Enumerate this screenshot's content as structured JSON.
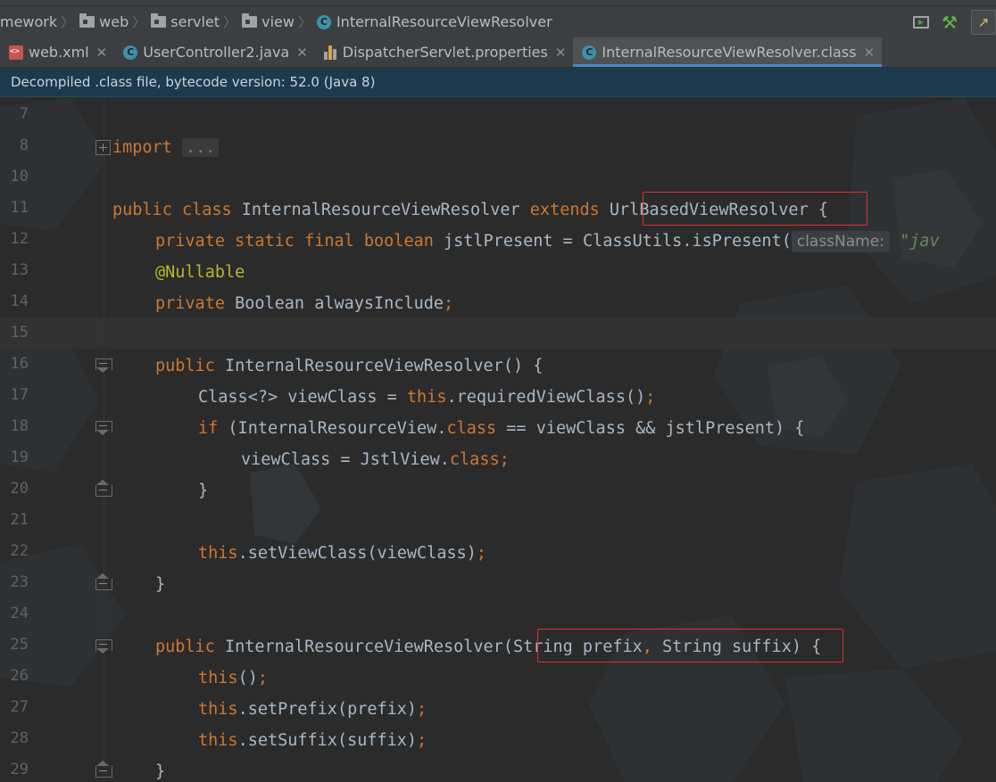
{
  "breadcrumb": {
    "items": [
      {
        "label": "mework",
        "icon": "none"
      },
      {
        "label": "web",
        "icon": "folder-icon"
      },
      {
        "label": "servlet",
        "icon": "folder-icon"
      },
      {
        "label": "view",
        "icon": "folder-icon"
      },
      {
        "label": "InternalResourceViewResolver",
        "icon": "class-icon"
      }
    ]
  },
  "toolbar": {
    "icons": [
      "run-configuration-icon",
      "build-hammer-icon",
      "run-icon"
    ]
  },
  "tabs": [
    {
      "label": "web.xml",
      "icon": "xml-file-icon",
      "active": false
    },
    {
      "label": "UserController2.java",
      "icon": "java-class-icon",
      "active": false
    },
    {
      "label": "DispatcherServlet.properties",
      "icon": "properties-file-icon",
      "active": false
    },
    {
      "label": "InternalResourceViewResolver.class",
      "icon": "java-class-icon",
      "active": true
    }
  ],
  "banner": {
    "text": "Decompiled .class file, bytecode version: 52.0 (Java 8)"
  },
  "editor": {
    "current_line": 15,
    "lines": [
      {
        "n": "7"
      },
      {
        "n": "8"
      },
      {
        "n": "10"
      },
      {
        "n": "11"
      },
      {
        "n": "12"
      },
      {
        "n": "13"
      },
      {
        "n": "14"
      },
      {
        "n": "15"
      },
      {
        "n": "16"
      },
      {
        "n": "17"
      },
      {
        "n": "18"
      },
      {
        "n": "19"
      },
      {
        "n": "20"
      },
      {
        "n": "21"
      },
      {
        "n": "22"
      },
      {
        "n": "23"
      },
      {
        "n": "24"
      },
      {
        "n": "25"
      },
      {
        "n": "26"
      },
      {
        "n": "27"
      },
      {
        "n": "28"
      },
      {
        "n": "29"
      }
    ],
    "code": {
      "l8_kw": "import",
      "l8_dots": "...",
      "l11_a": "public class",
      "l11_b": " InternalResourceViewResolver ",
      "l11_c": "extends",
      "l11_d": " UrlBasedViewResolver {",
      "l12_a": "private static final boolean",
      "l12_b": " jstlPresent = ClassUtils.isPresent(",
      "l12_hint": "className:",
      "l12_str": "\"jav",
      "l13": "@Nullable",
      "l14_a": "private",
      "l14_b": " Boolean alwaysInclude",
      "l14_c": ";",
      "l16_a": "public",
      "l16_b": " InternalResourceViewResolver() {",
      "l17_a": "Class<?> viewClass = ",
      "l17_b": "this",
      "l17_c": ".requiredViewClass()",
      "l17_d": ";",
      "l18_a": "if",
      "l18_b": " (InternalResourceView.",
      "l18_c": "class",
      "l18_d": " == viewClass && jstlPresent) {",
      "l19_a": "viewClass = JstlView.",
      "l19_b": "class;",
      "l20": "}",
      "l22_a": "this",
      "l22_b": ".setViewClass(viewClass)",
      "l22_c": ";",
      "l23": "}",
      "l25_a": "public",
      "l25_b": " InternalResourceViewResolver(String prefix",
      "l25_c": ",",
      "l25_d": " String suffix) {",
      "l26_a": "this",
      "l26_b": "()",
      "l26_c": ";",
      "l27_a": "this",
      "l27_b": ".setPrefix(prefix)",
      "l27_c": ";",
      "l28_a": "this",
      "l28_b": ".setSuffix(suffix)",
      "l28_c": ";",
      "l29": "}"
    }
  },
  "colors": {
    "keyword": "#cc7832",
    "annotation": "#bbb529",
    "identifier": "#a9b7c6",
    "highlight_box": "#e03030",
    "banner_bg": "#1d3a4d",
    "active_tab_underline": "#4a88c7"
  }
}
